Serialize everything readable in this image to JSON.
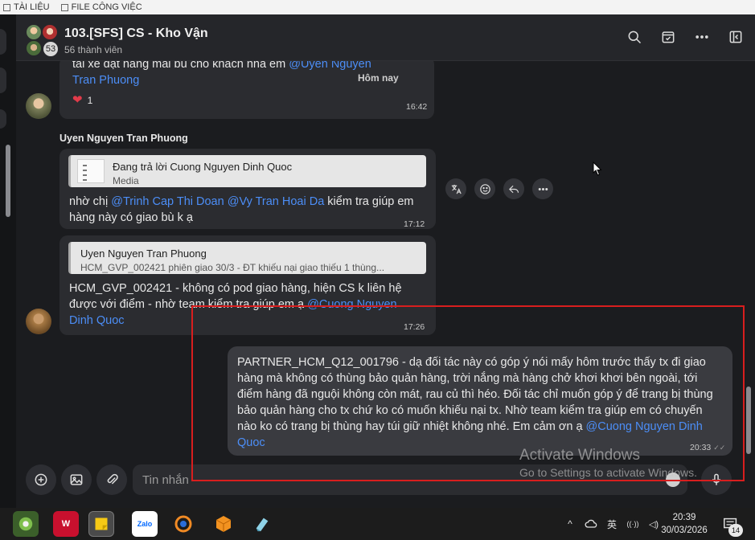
{
  "bookmarks": [
    "TÀI LIỆU",
    "FILE CÔNG VIỆC"
  ],
  "header": {
    "title": "103.[SFS] CS - Kho Vận",
    "members": "56 thành viên",
    "avatar_count": "53"
  },
  "messages": [
    {
      "text_prefix": "tài xế đặt hàng mài bù cho khách nha em ",
      "mention": "@Uyen Nguyen Tran Phuong",
      "date_label": "Hôm nay",
      "reaction_count": "1",
      "time": "16:42"
    },
    {
      "sender": "Uyen Nguyen Tran Phuong",
      "quote_title": "Đang trả lời Cuong Nguyen Dinh Quoc",
      "quote_sub": "Media",
      "text_prefix": "nhờ chị ",
      "mention1": "@Trinh Cap Thi Doan",
      "mention2": "@Vy Tran Hoai Da",
      "text_suffix": " kiểm tra giúp em hàng này có giao bù k ạ",
      "time": "17:12"
    },
    {
      "quote_title": "Uyen Nguyen Tran Phuong",
      "quote_sub": "HCM_GVP_002421 phiên giao 30/3 - ĐT khiếu nại giao thiếu 1 thùng...",
      "text_prefix": "HCM_GVP_002421 - không có pod giao hàng, hiện CS k liên hệ được với điểm - nhờ team kiểm tra giúp em ạ ",
      "mention": "@Cuong Nguyen Dinh Quoc",
      "time": "17:26"
    },
    {
      "text_prefix": "PARTNER_HCM_Q12_001796  - dạ đối tác này có góp ý nói mấy hôm trước thấy tx đi giao hàng mà không có thùng bảo quản hàng, trời nắng mà hàng chở khơi khơi bên ngoài, tới điểm hàng đã nguội không còn mát, rau củ thì héo. Đối tác chỉ muốn góp ý để trang bị thùng bảo quản hàng cho tx chứ ko có muốn khiếu nại tx. Nhờ team kiểm tra giúp em có chuyến nào ko có trang bị thùng hay túi giữ nhiệt không nhé. Em cảm ơn ạ ",
      "mention": "@Cuong Nguyen Dinh Quoc",
      "time": "20:33",
      "status": "✓✓"
    }
  ],
  "composer": {
    "placeholder": "Tin nhắn"
  },
  "watermark": {
    "line1": "Activate Windows",
    "line2": "Go to Settings to activate Windows."
  },
  "taskbar": {
    "time": "20:39",
    "date": "30/03/2026",
    "notifications": "14",
    "wps_label": "W",
    "zalo_label": "Zalo",
    "tray_up": "^",
    "tray_lang": "英",
    "tray_network": "((·))",
    "tray_volume": "◁)"
  },
  "colors": {
    "accent_mention": "#4c8ef7",
    "highlight_box": "#d81e1e",
    "heart": "#e23b4a"
  }
}
